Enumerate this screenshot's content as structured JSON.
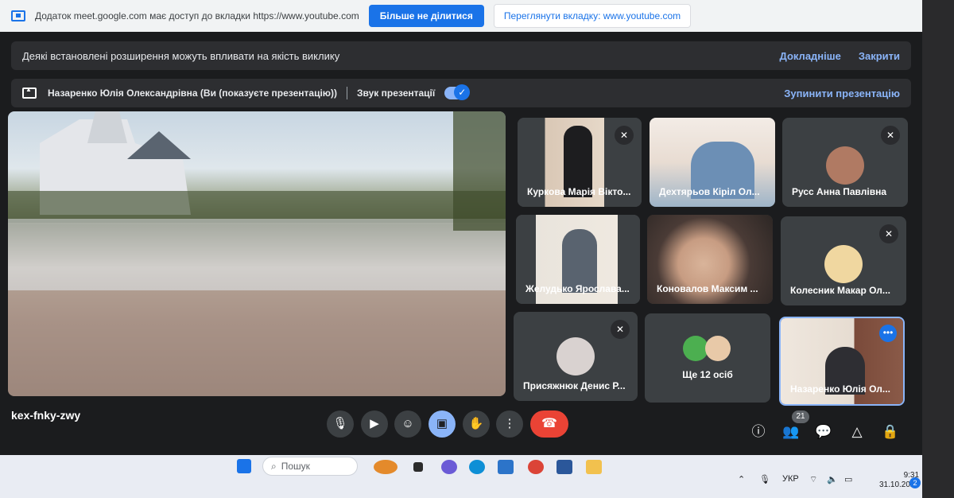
{
  "share_bar": {
    "message": "Додаток meet.google.com має доступ до вкладки https://www.youtube.com",
    "stop_sharing_label": "Більше не ділитися",
    "view_tab_label": "Переглянути вкладку: www.youtube.com"
  },
  "extensions_banner": {
    "text": "Деякі встановлені розширення можуть впливати на якість виклику",
    "details_label": "Докладніше",
    "close_label": "Закрити"
  },
  "presentation_bar": {
    "presenter_text": "Назаренко Юлія Олександрівна (Ви (показуєте презентацію))",
    "audio_label": "Звук презентації",
    "audio_enabled": true,
    "stop_label": "Зупинити презентацію"
  },
  "participants": [
    {
      "name": "Куркова Марія Вікто...",
      "muted": true
    },
    {
      "name": "Дехтярьов Кіріл Ол...",
      "muted": false
    },
    {
      "name": "Русс Анна Павлівна",
      "muted": true
    },
    {
      "name": "Желудько Ярослава...",
      "muted": false
    },
    {
      "name": "Коновалов Максим ...",
      "muted": false
    },
    {
      "name": "Колесник Макар Ол...",
      "muted": true
    },
    {
      "name": "Присяжнюк Денис Р...",
      "muted": true
    },
    {
      "name": "Ще 12 осіб",
      "muted": false
    },
    {
      "name": "Назаренко Юлія Ол...",
      "muted": false
    }
  ],
  "meeting_code": "kex-fnky-zwy",
  "participant_count": "21",
  "controls": {
    "mic": "microphone-icon",
    "camera": "camera-icon",
    "reactions": "emoji-icon",
    "present": "present-screen-icon",
    "hand": "raise-hand-icon",
    "more": "more-vert-icon",
    "leave": "hang-up-icon"
  },
  "colors": {
    "accent": "#8ab4f8",
    "primary": "#1a73e8",
    "leave": "#ea4335",
    "tile_bg": "#3c4043"
  },
  "taskbar": {
    "search_placeholder": "Пошук",
    "language": "УКР",
    "time": "9:31",
    "date": "31.10.2023",
    "notifications": "2"
  }
}
